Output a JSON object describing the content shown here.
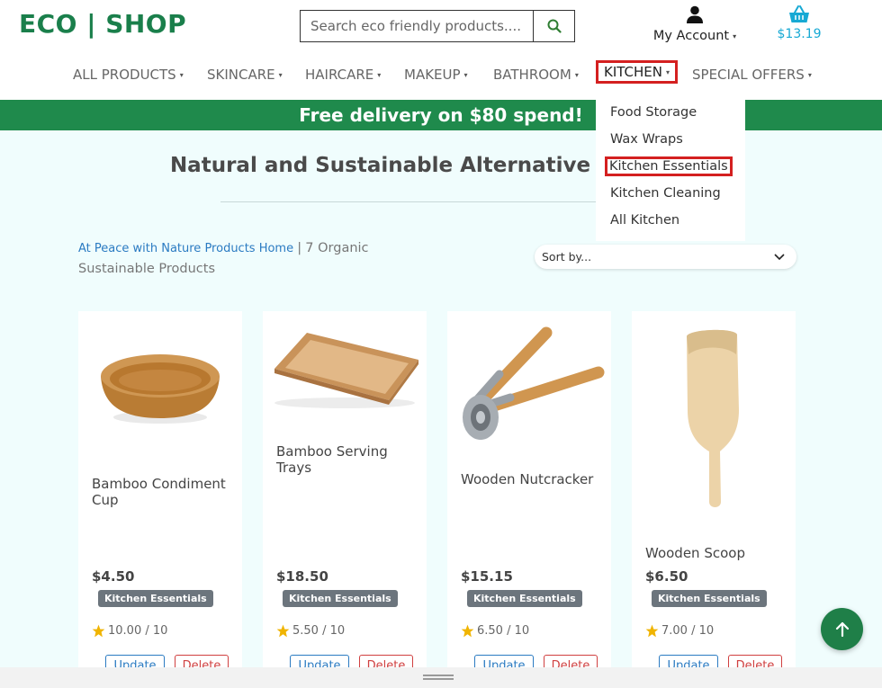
{
  "brand": {
    "logo": "ECO | SHOP",
    "accent": "#1a7f4b"
  },
  "search": {
    "placeholder": "Search eco friendly products...."
  },
  "account": {
    "label": "My Account"
  },
  "basket": {
    "total": "$13.19"
  },
  "nav": {
    "items": [
      {
        "label": "ALL PRODUCTS"
      },
      {
        "label": "SKINCARE"
      },
      {
        "label": "HAIRCARE"
      },
      {
        "label": "MAKEUP"
      },
      {
        "label": "BATHROOM"
      },
      {
        "label": "KITCHEN"
      },
      {
        "label": "SPECIAL OFFERS"
      }
    ],
    "active": "KITCHEN"
  },
  "kitchen_menu": {
    "items": [
      {
        "label": "Food Storage"
      },
      {
        "label": "Wax Wraps"
      },
      {
        "label": "Kitchen Essentials"
      },
      {
        "label": "Kitchen Cleaning"
      },
      {
        "label": "All Kitchen"
      }
    ],
    "highlighted": "Kitchen Essentials"
  },
  "banner": {
    "text": "Free delivery on $80 spend!",
    "color": "#1f8a4c"
  },
  "page": {
    "title": "Natural and Sustainable Alternative",
    "breadcrumb_link": "At Peace with Nature Products Home",
    "separator": "|",
    "breadcrumb_count": "7 Organic",
    "breadcrumb_tail": "Sustainable Products",
    "sort_label": "Sort by..."
  },
  "products": [
    {
      "name": "Bamboo Condiment Cup",
      "price": "$4.50",
      "category": "Kitchen Essentials",
      "rating": "10.00 / 10",
      "update": "Update",
      "delete": "Delete"
    },
    {
      "name": "Bamboo Serving Trays",
      "price": "$18.50",
      "category": "Kitchen Essentials",
      "rating": "5.50 / 10",
      "update": "Update",
      "delete": "Delete"
    },
    {
      "name": "Wooden Nutcracker",
      "price": "$15.15",
      "category": "Kitchen Essentials",
      "rating": "6.50 / 10",
      "update": "Update",
      "delete": "Delete"
    },
    {
      "name": "Wooden Scoop",
      "price": "$6.50",
      "category": "Kitchen Essentials",
      "rating": "7.00 / 10",
      "update": "Update",
      "delete": "Delete"
    }
  ],
  "icons": {
    "search": "search-icon",
    "account": "user-icon",
    "basket": "basket-icon",
    "sort": "chevron-down-icon",
    "rating": "star-icon",
    "back_to_top": "arrow-up-icon"
  }
}
